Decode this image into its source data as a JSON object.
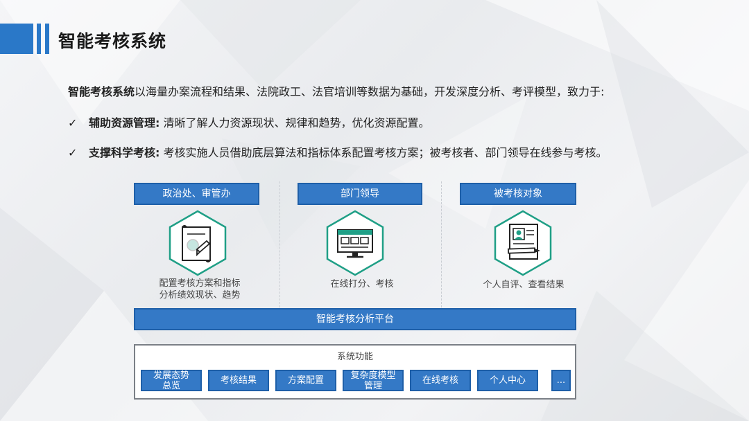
{
  "header": {
    "title": "智能考核系统"
  },
  "intro": {
    "bold": "智能考核系统",
    "text": "以海量办案流程和结果、法院政工、法官培训等数据为基础，开发深度分析、考评模型，致力于:"
  },
  "bullets": [
    {
      "check": "✓",
      "title": "辅助资源管理:",
      "text": " 清晰了解人力资源现状、规律和趋势，优化资源配置。"
    },
    {
      "check": "✓",
      "title": "支撑科学考核:",
      "text": " 考核实施人员借助底层算法和指标体系配置考核方案；被考核者、部门领导在线参与考核。"
    }
  ],
  "roles": [
    {
      "label": "政治处、审管办",
      "caption_line1": "配置考核方案和指标",
      "caption_line2": "分析绩效现状、趋势",
      "icon": "document-pen-icon"
    },
    {
      "label": "部门领导",
      "caption_line1": "在线打分、考核",
      "caption_line2": "",
      "icon": "monitor-icon"
    },
    {
      "label": "被考核对象",
      "caption_line1": "个人自评、查看结果",
      "caption_line2": "",
      "icon": "profile-document-icon"
    }
  ],
  "platform": {
    "label": "智能考核分析平台"
  },
  "functions": {
    "title": "系统功能",
    "items": [
      {
        "line1": "发展态势",
        "line2": "总览"
      },
      {
        "line1": "考核结果",
        "line2": ""
      },
      {
        "line1": "方案配置",
        "line2": ""
      },
      {
        "line1": "复杂度模型",
        "line2": "管理"
      },
      {
        "line1": "在线考核",
        "line2": ""
      },
      {
        "line1": "个人中心",
        "line2": ""
      },
      {
        "line1": "...",
        "line2": ""
      }
    ]
  },
  "colors": {
    "accent": "#2a78c8",
    "button": "#3479c6",
    "icon_teal": "#1f9f86"
  }
}
